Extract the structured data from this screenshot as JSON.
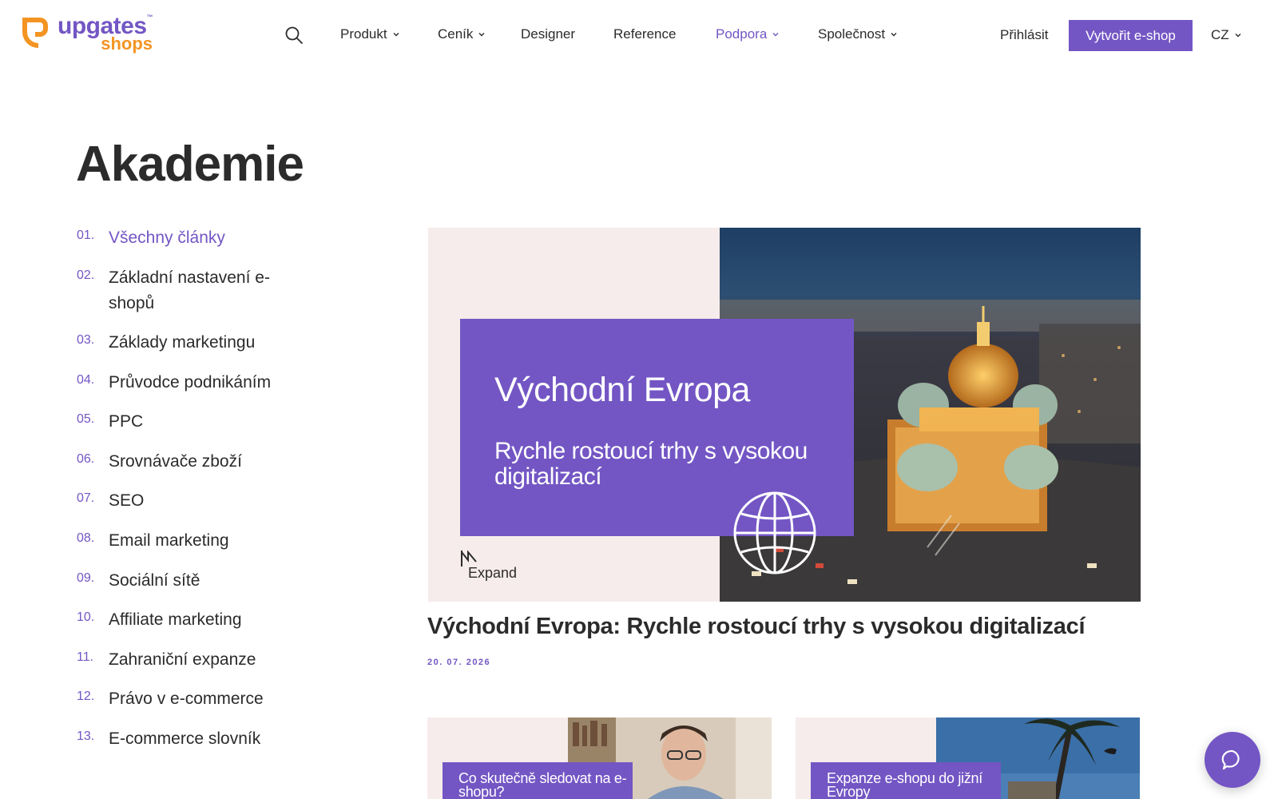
{
  "header": {
    "logo_primary": "upgates",
    "logo_tm": "™",
    "logo_secondary": "shops",
    "nav": [
      {
        "label": "Produkt",
        "dropdown": true
      },
      {
        "label": "Ceník",
        "dropdown": true
      },
      {
        "label": "Designer",
        "dropdown": false
      },
      {
        "label": "Reference",
        "dropdown": false
      },
      {
        "label": "Podpora",
        "dropdown": true,
        "active": true
      },
      {
        "label": "Společnost",
        "dropdown": true
      }
    ],
    "login_label": "Přihlásit",
    "cta_label": "Vytvořit e-shop",
    "language": "CZ"
  },
  "page_title": "Akademie",
  "sidebar": {
    "items": [
      {
        "num": "01.",
        "label": "Všechny články",
        "active": true
      },
      {
        "num": "02.",
        "label": "Základní nastavení e-shopů"
      },
      {
        "num": "03.",
        "label": "Základy marketingu"
      },
      {
        "num": "04.",
        "label": "Průvodce podnikáním"
      },
      {
        "num": "05.",
        "label": "PPC"
      },
      {
        "num": "06.",
        "label": "Srovnávače zboží"
      },
      {
        "num": "07.",
        "label": "SEO"
      },
      {
        "num": "08.",
        "label": "Email marketing"
      },
      {
        "num": "09.",
        "label": "Sociální sítě"
      },
      {
        "num": "10.",
        "label": "Affiliate marketing"
      },
      {
        "num": "11.",
        "label": "Zahraniční expanze"
      },
      {
        "num": "12.",
        "label": "Právo v e-commerce"
      },
      {
        "num": "13.",
        "label": "E-commerce slovník"
      }
    ]
  },
  "featured": {
    "image_title": "Východní Evropa",
    "image_subtitle": "Rychle rostoucí trhy s vysokou digitalizací",
    "image_brand": "Expand",
    "title": "Východní Evropa: Rychle rostoucí trhy s vysokou digitalizací",
    "date": "20. 07. 2026"
  },
  "cards": [
    {
      "label": "Co skutečně sledovat na e-shopu?"
    },
    {
      "label": "Expanze e-shopu do jižní Evropy"
    }
  ],
  "colors": {
    "accent": "#7356c4",
    "brand_orange": "#f39423",
    "text": "#2b2b2b",
    "image_bg": "#f6eceb"
  }
}
